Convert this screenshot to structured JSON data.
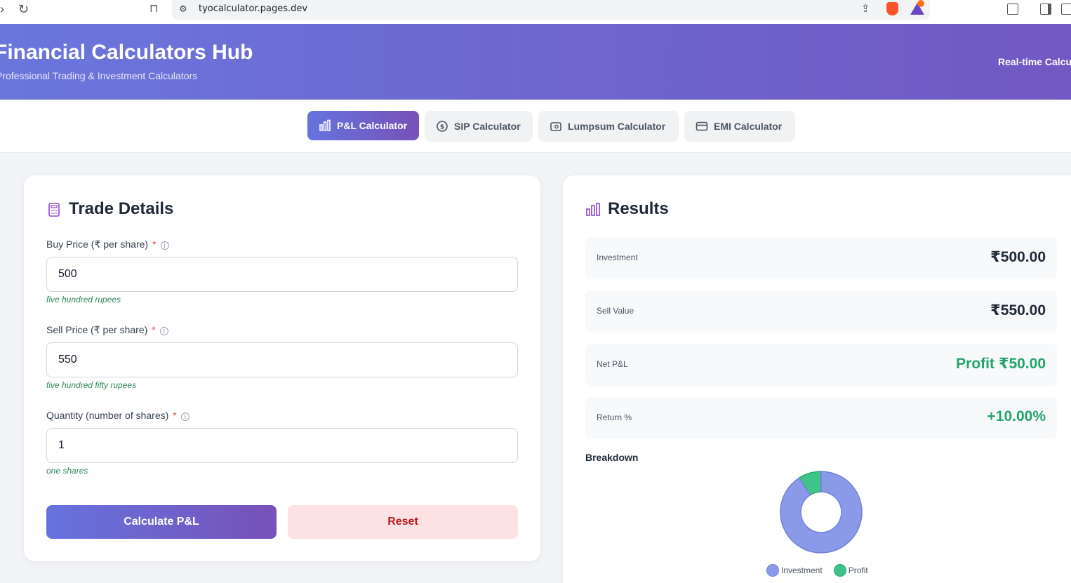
{
  "browser": {
    "url": "tyocalculator.pages.dev"
  },
  "header": {
    "title": "Financial Calculators Hub",
    "subtitle": "Professional Trading & Investment Calculators",
    "badge": "Real-time Calculations"
  },
  "tabs": [
    {
      "label": "P&L Calculator",
      "icon": "bar-chart-icon",
      "active": true
    },
    {
      "label": "SIP Calculator",
      "icon": "dollar-circle-icon",
      "active": false
    },
    {
      "label": "Lumpsum Calculator",
      "icon": "wallet-icon",
      "active": false
    },
    {
      "label": "EMI Calculator",
      "icon": "card-icon",
      "active": false
    }
  ],
  "trade": {
    "title": "Trade Details",
    "fields": [
      {
        "label": "Buy Price (₹ per share)",
        "required": "*",
        "value": "500",
        "hint": "five hundred rupees"
      },
      {
        "label": "Sell Price (₹ per share)",
        "required": "*",
        "value": "550",
        "hint": "five hundred fifty rupees"
      },
      {
        "label": "Quantity (number of shares)",
        "required": "*",
        "value": "1",
        "hint": "one shares"
      }
    ],
    "calculate_label": "Calculate P&L",
    "reset_label": "Reset"
  },
  "results": {
    "title": "Results",
    "rows": [
      {
        "label": "Investment",
        "value": "₹500.00"
      },
      {
        "label": "Sell Value",
        "value": "₹550.00"
      },
      {
        "label": "Net P&L",
        "value": "Profit ₹50.00"
      },
      {
        "label": "Return %",
        "value": "+10.00%"
      }
    ],
    "breakdown_title": "Breakdown"
  },
  "chart_data": {
    "type": "pie",
    "categories": [
      "Investment",
      "Profit"
    ],
    "values": [
      500,
      50
    ],
    "colors": [
      "#8b9ae8",
      "#3ec48a"
    ]
  },
  "colors": {
    "accent": "#6673de",
    "accent_end": "#7751b8",
    "profit": "#22a46c",
    "reset_bg": "#fde2e4",
    "reset_text": "#b91c1c"
  }
}
